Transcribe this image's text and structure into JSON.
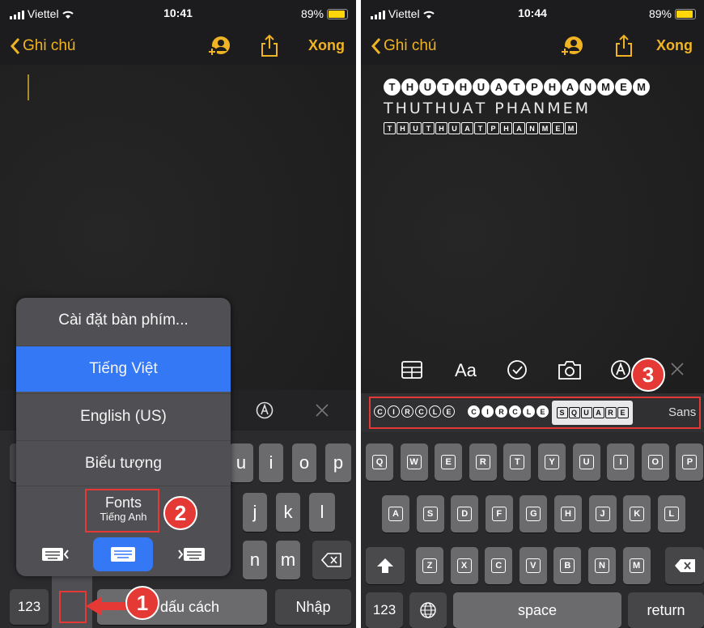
{
  "left": {
    "status": {
      "carrier": "Viettel",
      "time": "10:41",
      "battery": "89%"
    },
    "nav": {
      "back_label": "Ghi chú",
      "done_label": "Xong"
    },
    "popup": {
      "items": [
        "Cài đặt bàn phím...",
        "Tiếng Việt",
        "English (US)",
        "Biểu tượng"
      ],
      "fonts_label": "Fonts",
      "fonts_sub": "Tiếng Anh",
      "selected": "Tiếng Việt"
    },
    "keys": {
      "row2": [
        "u",
        "i",
        "o",
        "p"
      ],
      "row3": [
        "j",
        "k",
        "l"
      ],
      "row4": [
        "n",
        "m"
      ],
      "numbers": "123",
      "space": "dấu cách",
      "return": "Nhập"
    },
    "badges": [
      "1",
      "2"
    ]
  },
  "right": {
    "status": {
      "carrier": "Viettel",
      "time": "10:44",
      "battery": "89%"
    },
    "nav": {
      "back_label": "Ghi chú",
      "done_label": "Xong"
    },
    "note_lines": {
      "line1": "THUTHUATPHANMEM",
      "line2": "ТHUТHUАТ ΡHАNMЕM",
      "line3": "THUTHUATPHANMEM"
    },
    "toolbar": {
      "format_label": "Aa"
    },
    "font_bar": {
      "items": [
        "CIRCLE",
        "CIRCLE",
        "SQUARE",
        "Sans"
      ],
      "selected": "SQUARE"
    },
    "keys": {
      "row1": [
        "Q",
        "W",
        "E",
        "R",
        "T",
        "Y",
        "U",
        "I",
        "O",
        "P"
      ],
      "row2": [
        "A",
        "S",
        "D",
        "F",
        "G",
        "H",
        "J",
        "K",
        "L"
      ],
      "row3": [
        "Z",
        "X",
        "C",
        "V",
        "B",
        "N",
        "M"
      ],
      "numbers": "123",
      "space": "space",
      "return": "return"
    },
    "badge": "3"
  },
  "colors": {
    "accent": "#f0b323",
    "selected_blue": "#3478f6",
    "annotation_red": "#e53935"
  }
}
